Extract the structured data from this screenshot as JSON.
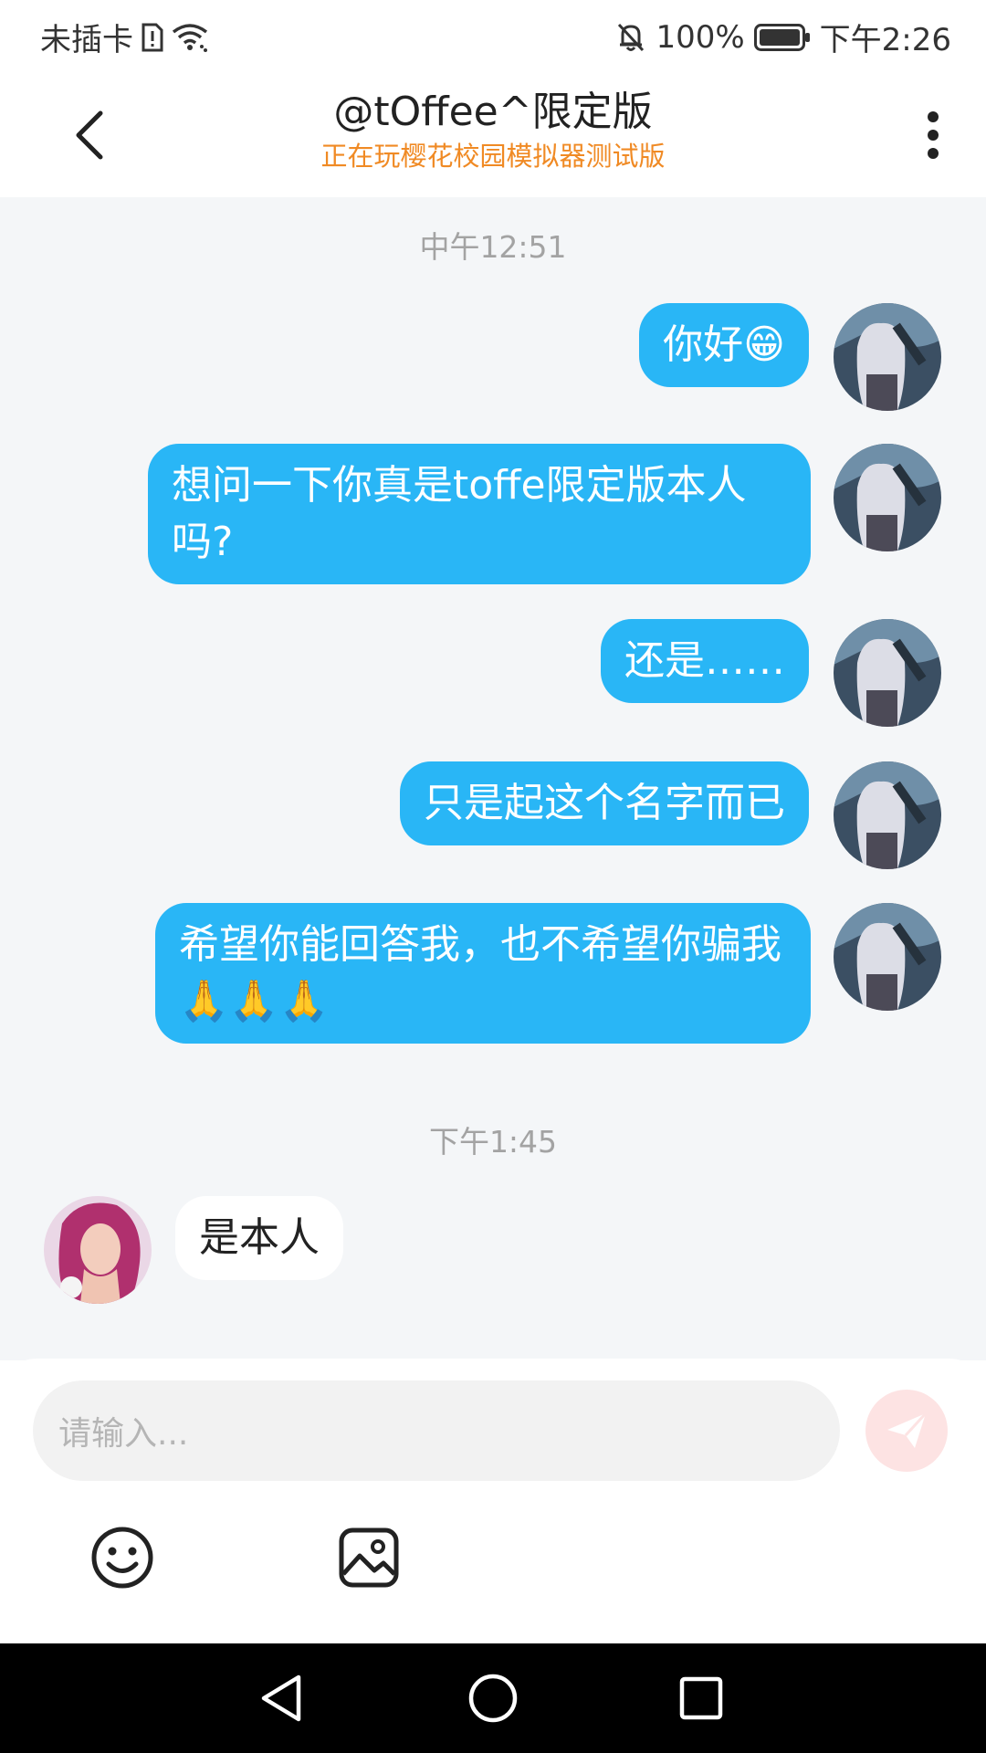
{
  "status_bar": {
    "carrier": "未插卡",
    "battery": "100%",
    "time": "下午2:26",
    "icons": [
      "sim-alert-icon",
      "wifi-icon",
      "mute-bell-icon",
      "battery-icon"
    ]
  },
  "header": {
    "title": "@tOffee^限定版",
    "subtitle": "正在玩樱花校园模拟器测试版",
    "icons": [
      "back-arrow-icon",
      "more-vertical-icon"
    ]
  },
  "chat": {
    "timestamps": [
      "中午12:51",
      "下午1:45"
    ],
    "messages": [
      {
        "from": "me",
        "text": "你好😁"
      },
      {
        "from": "me",
        "text": "想问一下你真是toffe限定版本人吗?"
      },
      {
        "from": "me",
        "text": "还是……"
      },
      {
        "from": "me",
        "text": "只是起这个名字而已"
      },
      {
        "from": "me",
        "text": "希望你能回答我，也不希望你骗我🙏🙏🙏"
      },
      {
        "from": "them",
        "text": "是本人"
      }
    ]
  },
  "input": {
    "placeholder": "请输入..."
  },
  "toolbar": {
    "icons": [
      "emoji-icon",
      "image-icon",
      "send-icon"
    ]
  },
  "nav_bar": {
    "icons": [
      "nav-back-icon",
      "nav-home-icon",
      "nav-recents-icon"
    ]
  },
  "colors": {
    "bubble_out": "#29b6f6",
    "bubble_in": "#ffffff",
    "chat_bg": "#f4f6f8",
    "subtitle": "#f08a24",
    "send_bg": "#fde3e3"
  }
}
